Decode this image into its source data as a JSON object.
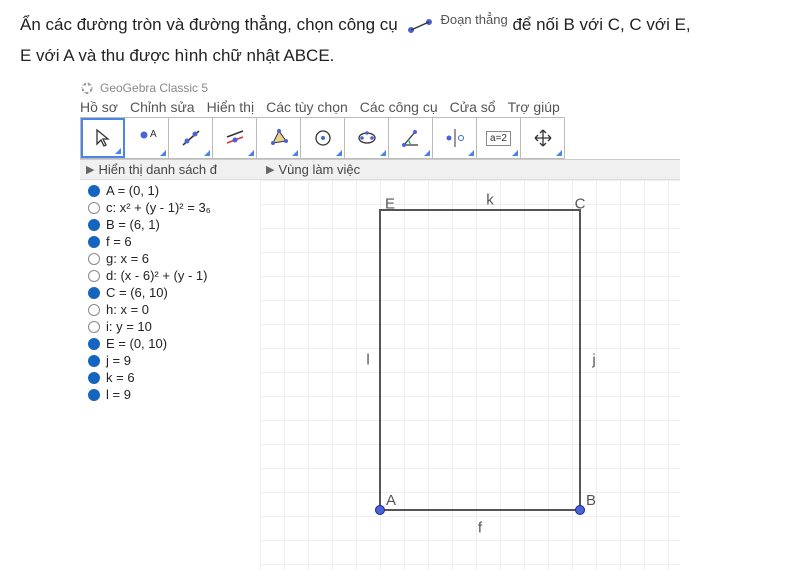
{
  "instruction": {
    "part1": "Ẩn các đường tròn và đường thẳng, chọn công cụ",
    "tool_label": "Đoạn thẳng",
    "part2": "để nối B với C, C với E,",
    "part3": "E với A và thu được hình chữ nhật ABCE."
  },
  "app": {
    "title": "GeoGebra Classic 5",
    "menu": [
      "Hồ sơ",
      "Chỉnh sửa",
      "Hiển thị",
      "Các tùy chọn",
      "Các công cụ",
      "Cửa sổ",
      "Trợ giúp"
    ],
    "left_panel_title": "Hiển thị danh sách đ",
    "right_panel_title": "Vùng làm việc",
    "slider_text": "a=2"
  },
  "toolbar_icons": [
    "arrow-icon",
    "point-icon",
    "line-icon",
    "parallel-icon",
    "polygon-icon",
    "circle-icon",
    "conic-icon",
    "angle-icon",
    "reflect-icon",
    "slider-icon",
    "move-view-icon"
  ],
  "objects": [
    {
      "filled": true,
      "label": "A = (0, 1)"
    },
    {
      "filled": false,
      "label": "c: x² + (y - 1)² = 3₆"
    },
    {
      "filled": true,
      "label": "B = (6, 1)"
    },
    {
      "filled": true,
      "label": "f = 6"
    },
    {
      "filled": false,
      "label": "g: x = 6"
    },
    {
      "filled": false,
      "label": "d: (x - 6)² + (y - 1)"
    },
    {
      "filled": true,
      "label": "C = (6, 10)"
    },
    {
      "filled": false,
      "label": "h: x = 0"
    },
    {
      "filled": false,
      "label": "i: y = 10"
    },
    {
      "filled": true,
      "label": "E = (0, 10)"
    },
    {
      "filled": true,
      "label": "j = 9"
    },
    {
      "filled": true,
      "label": "k = 6"
    },
    {
      "filled": true,
      "label": "l = 9"
    }
  ],
  "points": {
    "A": {
      "label": "A"
    },
    "B": {
      "label": "B"
    },
    "C": {
      "label": "C"
    },
    "E": {
      "label": "E"
    }
  },
  "edges": {
    "f": "f",
    "j": "j",
    "k": "k",
    "l": "l"
  },
  "chart_data": {
    "type": "diagram",
    "points": {
      "A": [
        0,
        1
      ],
      "B": [
        6,
        1
      ],
      "C": [
        6,
        10
      ],
      "E": [
        0,
        10
      ]
    },
    "segments": [
      {
        "name": "f",
        "from": "A",
        "to": "B",
        "length": 6
      },
      {
        "name": "j",
        "from": "B",
        "to": "C",
        "length": 9
      },
      {
        "name": "k",
        "from": "C",
        "to": "E",
        "length": 6
      },
      {
        "name": "l",
        "from": "E",
        "to": "A",
        "length": 9
      }
    ],
    "shape": "rectangle ABCE"
  }
}
